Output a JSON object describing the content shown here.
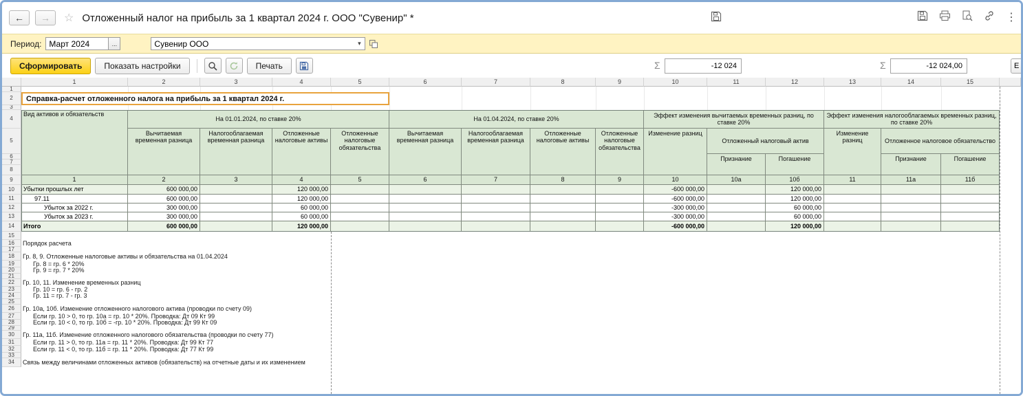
{
  "colors": {
    "header_green": "#d9e7d3",
    "row_green": "#ebf3e6",
    "button_yellow": "#fcd116",
    "period_bar_yellow": "#fff3c2",
    "selection_orange": "#e8a33d",
    "window_frame_blue": "#84a9d4"
  },
  "icons": {
    "back": "←",
    "forward": "→",
    "star": "☆",
    "sigma": "Σ",
    "dots": "⋮",
    "caret": "▾",
    "ellipsis": "..."
  },
  "window": {
    "title": "Отложенный налог на прибыль за 1 квартал 2024 г. ООО \"Сувенир\" *"
  },
  "period_bar": {
    "label": "Период:",
    "period_value": "Март 2024",
    "organization": "Сувенир ООО"
  },
  "toolbar": {
    "generate": "Сформировать",
    "show_settings": "Показать настройки",
    "print": "Печать",
    "sum1": "-12 024",
    "sum2": "-12 024,00",
    "more": "Е"
  },
  "sheet": {
    "col_headers": [
      "1",
      "2",
      "3",
      "4",
      "5",
      "6",
      "7",
      "8",
      "9",
      "10",
      "11",
      "12",
      "13",
      "14",
      "15"
    ],
    "row_headers": [
      "1",
      "2",
      "3",
      "4",
      "5",
      "6",
      "7",
      "8",
      "9",
      "10",
      "11",
      "12",
      "13",
      "14",
      "15",
      "16",
      "17",
      "18",
      "19",
      "20",
      "21",
      "22",
      "23",
      "24",
      "25",
      "26",
      "27",
      "28",
      "29",
      "30",
      "31",
      "32",
      "33",
      "34"
    ],
    "report_title": "Справка-расчет отложенного налога на прибыль за 1 квартал 2024 г.",
    "head": {
      "kind": "Вид активов и обязательств",
      "g1": "На 01.01.2024, по ставке 20%",
      "g2": "На 01.04.2024, по ставке 20%",
      "g3": "Эффект изменения вычитаемых временных разниц, по ставке 20%",
      "g4": "Эффект изменения налогооблагаемых временных разниц, по ставке 20%",
      "deductible": "Вычитаемая временная разница",
      "taxable": "Налогооблагаемая временная разница",
      "dta": "Отложенные налоговые активы",
      "dtl": "Отложенные налоговые обязательства",
      "diff_change": "Изменение разниц",
      "dta_single": "Отложенный налоговый актив",
      "dtl_single": "Отложенное налоговое обязательство",
      "recognition": "Признание",
      "settlement": "Погашение",
      "nums": [
        "1",
        "2",
        "3",
        "4",
        "5",
        "6",
        "7",
        "8",
        "9",
        "10",
        "10а",
        "10б",
        "11",
        "11а",
        "11б"
      ]
    },
    "rows": [
      {
        "label": "Убытки прошлых лет",
        "c2": "600 000,00",
        "c4": "120 000,00",
        "c10": "-600 000,00",
        "c12": "120 000,00"
      },
      {
        "label": "97.11",
        "c2": "600 000,00",
        "c4": "120 000,00",
        "c10": "-600 000,00",
        "c12": "120 000,00"
      },
      {
        "label": "Убыток за 2022 г.",
        "c2": "300 000,00",
        "c4": "60 000,00",
        "c10": "-300 000,00",
        "c12": "60 000,00"
      },
      {
        "label": "Убыток за 2023 г.",
        "c2": "300 000,00",
        "c4": "60 000,00",
        "c10": "-300 000,00",
        "c12": "60 000,00"
      },
      {
        "label": "Итого",
        "c2": "600 000,00",
        "c4": "120 000,00",
        "c10": "-600 000,00",
        "c12": "120 000,00"
      }
    ],
    "notes": [
      "Порядок расчета",
      "Гр. 8, 9. Отложенные налоговые активы и обязательства на 01.04.2024",
      "Гр. 8 = гр. 6 * 20%",
      "Гр. 9 = гр. 7 * 20%",
      "Гр. 10, 11. Изменение временных разниц",
      "Гр. 10 = гр. 6 - гр. 2",
      "Гр. 11 = гр. 7 - гр. 3",
      "Гр. 10а, 10б. Изменение отложенного налогового актива (проводки по счету 09)",
      "Если гр. 10 > 0, то гр. 10а = гр. 10 * 20%. Проводка: Дт 09 Кт 99",
      "Если гр. 10 < 0, то гр. 10б = -гр. 10 * 20%. Проводка: Дт 99 Кт 09",
      "Гр. 11а, 11б. Изменение отложенного налогового обязательства (проводки по счету 77)",
      "Если гр. 11 > 0, то гр. 11а = гр. 11 * 20%. Проводка: Дт 99 Кт 77",
      "Если гр. 11 < 0, то гр. 11б = гр. 11 * 20%. Проводка: Дт 77 Кт 99",
      "Связь между величинами отложенных активов (обязательств) на отчетные даты и их изменением"
    ]
  }
}
